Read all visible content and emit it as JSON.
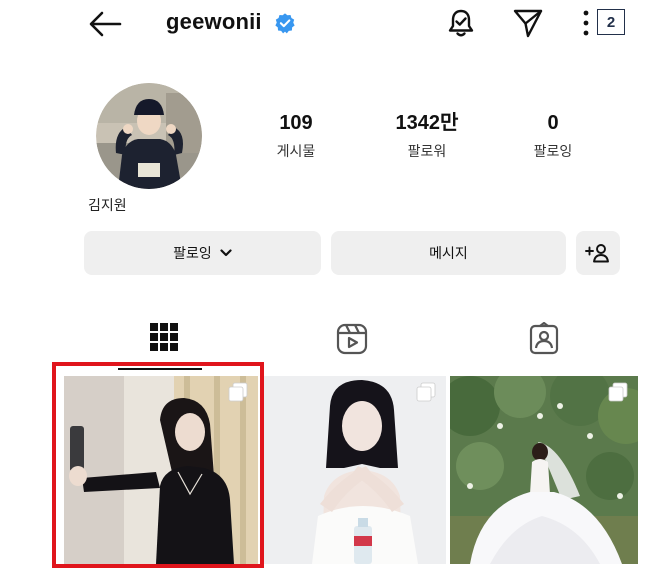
{
  "header": {
    "username": "geewonii",
    "verified_icon": "verified-badge-icon",
    "page_badge": "2",
    "accent_color": "#3897f0"
  },
  "profile": {
    "display_name": "김지원",
    "stats": {
      "posts": {
        "value": "109",
        "label": "게시물"
      },
      "followers": {
        "value": "1342만",
        "label": "팔로워"
      },
      "following": {
        "value": "0",
        "label": "팔로잉"
      }
    }
  },
  "actions": {
    "following_label": "팔로잉",
    "message_label": "메시지",
    "add_user_icon": "add-user-icon"
  },
  "tabs": [
    {
      "icon": "grid-icon",
      "active": true
    },
    {
      "icon": "reels-icon",
      "active": false
    },
    {
      "icon": "tagged-icon",
      "active": false
    }
  ],
  "posts": [
    {
      "type": "multi-image",
      "highlighted": true
    },
    {
      "type": "multi-image",
      "highlighted": false
    },
    {
      "type": "multi-image",
      "highlighted": false
    }
  ],
  "highlight_color": "#e0151c"
}
